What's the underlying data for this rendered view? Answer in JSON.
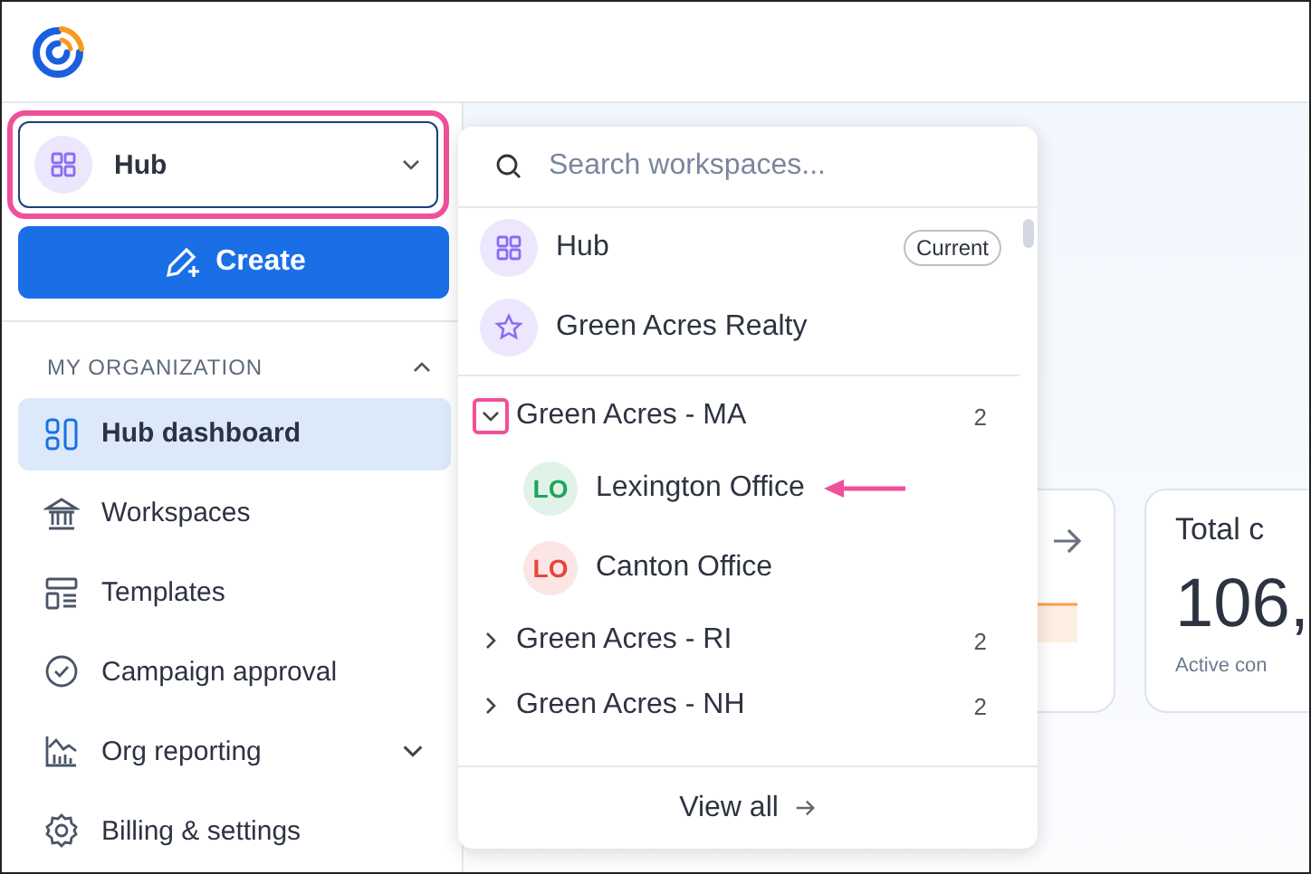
{
  "workspace_selector": {
    "label": "Hub"
  },
  "create_button": {
    "label": "Create"
  },
  "sidebar": {
    "section": {
      "title": "MY ORGANIZATION",
      "expanded": true
    },
    "items": [
      {
        "label": "Hub dashboard",
        "selected": true,
        "expandable": false
      },
      {
        "label": "Workspaces",
        "selected": false,
        "expandable": false
      },
      {
        "label": "Templates",
        "selected": false,
        "expandable": false
      },
      {
        "label": "Campaign approval",
        "selected": false,
        "expandable": false
      },
      {
        "label": "Org reporting",
        "selected": false,
        "expandable": true
      },
      {
        "label": "Billing & settings",
        "selected": false,
        "expandable": false
      }
    ]
  },
  "workspace_menu": {
    "search": {
      "placeholder": "Search workspaces..."
    },
    "pinned": [
      {
        "label": "Hub",
        "badge": "Current"
      },
      {
        "label": "Green Acres Realty"
      }
    ],
    "groups": [
      {
        "label": "Green Acres - MA",
        "count": "2",
        "expanded": true,
        "children": [
          {
            "initials": "LO",
            "label": "Lexington Office",
            "color": "#1fa55a"
          },
          {
            "initials": "LO",
            "label": "Canton Office",
            "color": "#e4463b"
          }
        ]
      },
      {
        "label": "Green Acres - RI",
        "count": "2",
        "expanded": false
      },
      {
        "label": "Green Acres - NH",
        "count": "2",
        "expanded": false
      }
    ],
    "footer": {
      "label": "View all"
    }
  },
  "cards": [
    {
      "kind": "trend"
    },
    {
      "kind": "stat",
      "title": "Total c",
      "value": "106,",
      "caption": "Active con"
    }
  ]
}
